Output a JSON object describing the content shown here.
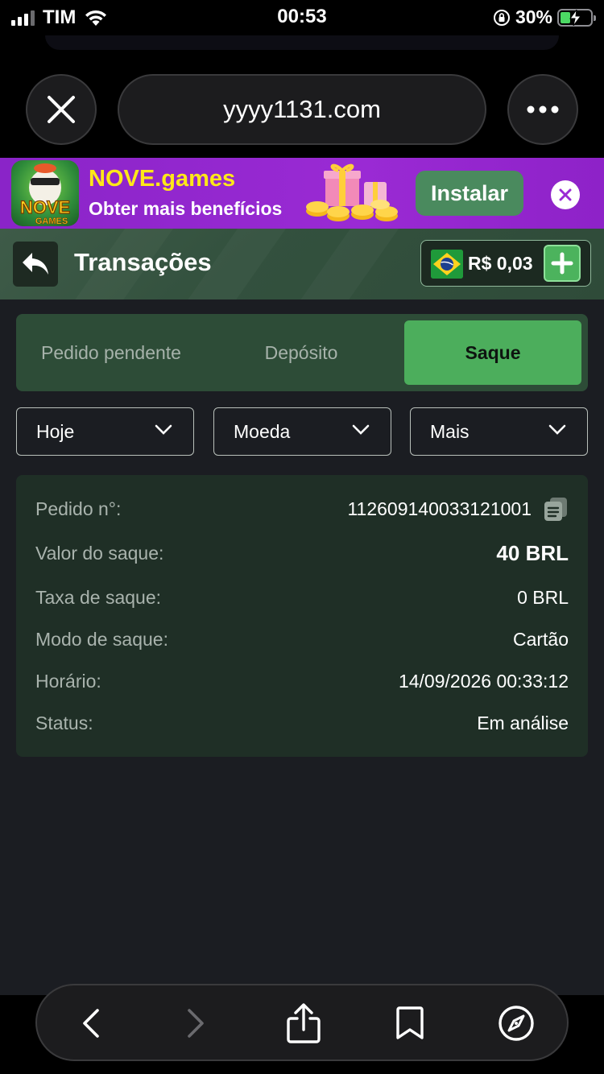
{
  "status_bar": {
    "carrier": "TIM",
    "time": "00:53",
    "battery_percent": "30%"
  },
  "browser": {
    "url": "yyyy1131.com",
    "icons": [
      "close-icon",
      "more-icon",
      "back-icon",
      "forward-icon",
      "share-icon",
      "bookmarks-icon",
      "compass-icon"
    ]
  },
  "banner": {
    "app_name": "NOVE.games",
    "subtitle": "Obter mais benefícios",
    "install_label": "Instalar",
    "app_icon_text": "NOVE GAMES"
  },
  "header": {
    "title": "Transações",
    "balance": "R$ 0,03",
    "colors": {
      "accent": "#4cae5c",
      "header_bg": "#33513e"
    }
  },
  "tabs": [
    {
      "label": "Pedido pendente",
      "active": false
    },
    {
      "label": "Depósito",
      "active": false
    },
    {
      "label": "Saque",
      "active": true
    }
  ],
  "filters": [
    {
      "label": "Hoje"
    },
    {
      "label": "Moeda"
    },
    {
      "label": "Mais"
    }
  ],
  "transaction": {
    "order_label": "Pedido n°:",
    "order_value": "112609140033121001",
    "amount_label": "Valor do saque:",
    "amount_value": "40 BRL",
    "fee_label": "Taxa de saque:",
    "fee_value": "0 BRL",
    "mode_label": "Modo de saque:",
    "mode_value": "Cartão",
    "time_label": "Horário:",
    "time_value": "14/09/2026 00:33:12",
    "status_label": "Status:",
    "status_value": "Em análise"
  }
}
